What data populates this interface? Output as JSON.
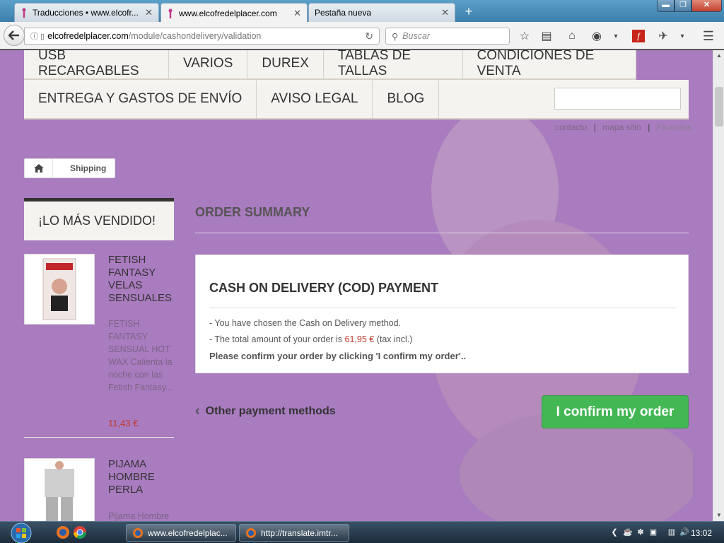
{
  "browser": {
    "tabs": [
      {
        "title": "Traducciones • www.elcofr...",
        "close": "✕"
      },
      {
        "title": "www.elcofredelplacer.com",
        "close": "✕"
      },
      {
        "title": "Pestaña nueva",
        "close": "✕"
      }
    ],
    "new_tab": "+",
    "url_host": "elcofredelplacer.com",
    "url_path": "/module/cashondelivery/validation",
    "search_placeholder": "Buscar",
    "window_min": "▬",
    "window_max": "❐",
    "window_close": "✕"
  },
  "menu": {
    "row1": [
      "USB RECARGABLES",
      "VARIOS",
      "DUREX",
      "TABLAS DE TALLAS",
      "CONDICIONES DE VENTA"
    ],
    "row2": [
      "ENTREGA Y GASTOS DE ENVÍO",
      "AVISO LEGAL",
      "BLOG"
    ]
  },
  "header_links": {
    "contact": "contacto",
    "sitemap": "mapa sitio",
    "favorites": "Favoritos",
    "sep": "|"
  },
  "breadcrumb": {
    "current": "Shipping"
  },
  "sidebar": {
    "title": "¡LO MÁS VENDIDO!",
    "products": [
      {
        "name": "FETISH FANTASY VELAS SENSUALES",
        "description": "FETISH FANTASY SENSUAL HOT WAX Calienta la noche con las Fetish Fantasy...",
        "price": "11,43 €"
      },
      {
        "name": "PIJAMA HOMBRE PERLA",
        "description": "Pijama Hombre"
      }
    ]
  },
  "main": {
    "heading": "ORDER SUMMARY",
    "cod": {
      "title": "CASH ON DELIVERY (COD) PAYMENT",
      "line1": "- You have chosen the Cash on Delivery method.",
      "line2_prefix": "- The total amount of your order is ",
      "total": "61,95 €",
      "line2_suffix": " (tax incl.)",
      "confirm_text": "Please confirm your order by clicking 'I confirm my order'.."
    },
    "other_methods": "Other payment methods",
    "confirm_button": "I confirm my order"
  },
  "taskbar": {
    "tasks": [
      "www.elcofredelplac...",
      "http://translate.imtr..."
    ],
    "clock": "13:02"
  },
  "colors": {
    "page_bg": "#a97bbf",
    "confirm_green": "#43b754",
    "price_red": "#c0392b"
  }
}
